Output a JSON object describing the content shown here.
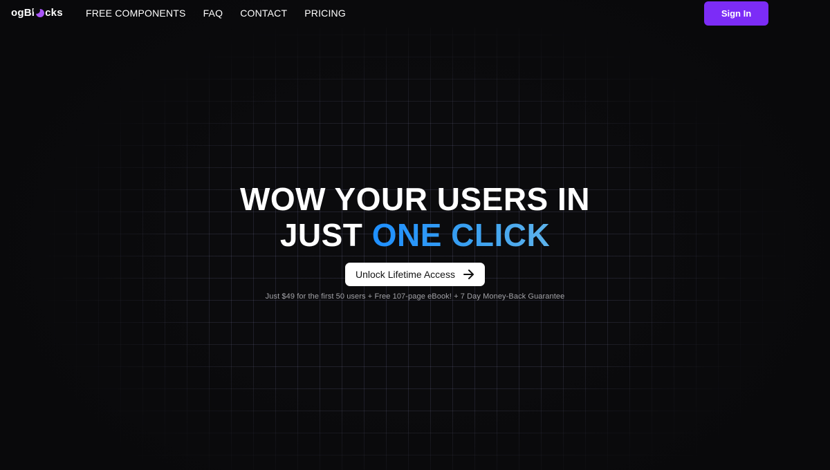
{
  "brand": {
    "logo_prefix": "ogBl",
    "logo_suffix": "cks",
    "logo_icon": "moon-icon",
    "accent_color": "#a855f7"
  },
  "nav": {
    "links": [
      {
        "label": "FREE COMPONENTS"
      },
      {
        "label": "FAQ"
      },
      {
        "label": "CONTACT"
      },
      {
        "label": "PRICING"
      }
    ],
    "signin_label": "Sign In",
    "signin_color": "#7c2cf7"
  },
  "hero": {
    "line1": "WOW YOUR USERS IN",
    "line2_plain": "JUST ",
    "line2_accent": "ONE CLICK",
    "accent_gradient": [
      "#1e8fff",
      "#5db3ec"
    ],
    "cta_label": "Unlock Lifetime Access",
    "cta_icon": "arrow-right-icon",
    "subtext": "Just $49 for the first 50 users + Free 107-page eBook! + 7 Day Money-Back Guarantee"
  },
  "colors": {
    "background": "#0b0b0d",
    "text": "#ffffff",
    "muted": "#a3a3a8"
  }
}
